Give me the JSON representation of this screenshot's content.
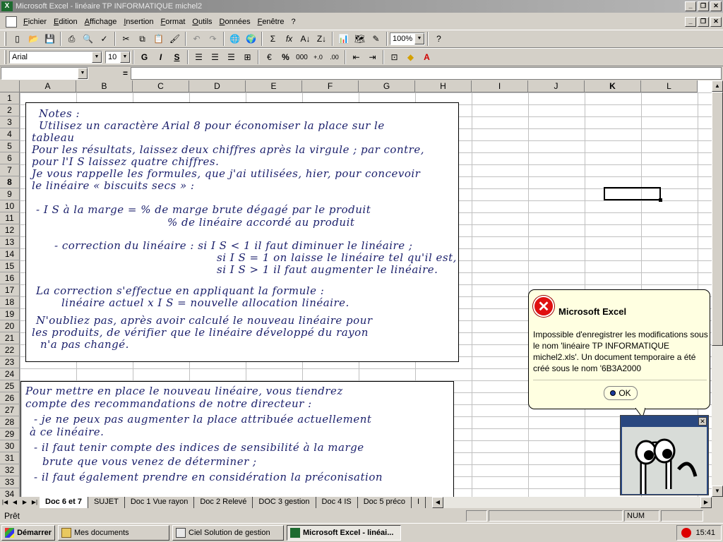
{
  "window": {
    "title": "Microsoft Excel - linéaire TP INFORMATIQUE michel2",
    "logo": "X"
  },
  "menu": [
    "Fichier",
    "Edition",
    "Affichage",
    "Insertion",
    "Format",
    "Outils",
    "Données",
    "Fenêtre",
    "?"
  ],
  "toolbar": {
    "zoom": "100%"
  },
  "format_toolbar": {
    "font": "Arial",
    "size": "10",
    "bold": "G",
    "italic": "I",
    "underline": "S",
    "percent": "%",
    "thousands": "000"
  },
  "formula_bar": {
    "name_box": "",
    "eq": "=",
    "value": ""
  },
  "columns": [
    "A",
    "B",
    "C",
    "D",
    "E",
    "F",
    "G",
    "H",
    "I",
    "J",
    "K",
    "L"
  ],
  "selected_column": "K",
  "selected_row": "8",
  "rows": [
    "1",
    "2",
    "3",
    "4",
    "5",
    "6",
    "7",
    "8",
    "9",
    "10",
    "11",
    "12",
    "13",
    "14",
    "15",
    "16",
    "17",
    "18",
    "19",
    "20",
    "21",
    "22",
    "23",
    "24",
    "25",
    "26",
    "27",
    "28",
    "29",
    "30",
    "31",
    "32",
    "33",
    "34"
  ],
  "note1_lines": [
    "Notes :",
    "Utilisez un caractère Arial 8 pour économiser la place sur le",
    "tableau",
    "Pour les résultats, laissez deux chiffres après la virgule ; par contre,",
    "pour l'I S laissez quatre chiffres.",
    "Je vous rappelle les formules, que j'ai utilisées, hier, pour concevoir",
    "le linéaire « biscuits secs » :",
    "- I S à la marge =  % de marge brute dégagé par le produit",
    "% de linéaire accordé au produit",
    "- correction du linéaire :  si I S < 1 il faut diminuer le linéaire ;",
    "si I S = 1 on laisse le linéaire tel qu'il est,",
    "si I S > 1 il faut augmenter le linéaire.",
    "La correction s'effectue en appliquant la formule :",
    "linéaire actuel x I S = nouvelle allocation linéaire.",
    "N'oubliez pas, après avoir calculé le nouveau linéaire pour",
    "les produits, de vérifier que le linéaire développé du rayon",
    "n'a pas changé."
  ],
  "note2_lines": [
    "Pour mettre en place le nouveau linéaire, vous tiendrez",
    "compte des recommandations de notre directeur :",
    "- je ne peux pas augmenter la place attribuée actuellement",
    "à ce linéaire.",
    "- il faut tenir compte des indices de sensibilité à la marge",
    "brute que vous venez de déterminer ;",
    "- il faut également prendre en considération la préconisation"
  ],
  "sheet_tabs": [
    "Doc 6 et 7",
    "SUJET",
    "Doc 1  Vue rayon",
    "Doc 2 Relevé",
    "DOC 3 gestion",
    "Doc 4  IS",
    "Doc 5 préco",
    "I"
  ],
  "active_tab": 0,
  "status": {
    "text": "Prêt",
    "num": "NUM"
  },
  "taskbar": {
    "start": "Démarrer",
    "items": [
      "Mes documents",
      "Ciel Solution de gestion",
      "Microsoft Excel - linéai..."
    ],
    "active": 2,
    "clock": "15:41"
  },
  "balloon": {
    "title": "Microsoft Excel",
    "message": "Impossible d'enregistrer les modifications sous le nom 'linéaire TP INFORMATIQUE michel2.xls'. Un document temporaire a été créé sous le nom '6B3A2000",
    "ok": "OK",
    "icon": "error-x-icon"
  },
  "colors": {
    "titlebar_inactive": "#7f7f7f",
    "balloon_bg": "#ffffe1",
    "ink": "#1a1f6b"
  }
}
